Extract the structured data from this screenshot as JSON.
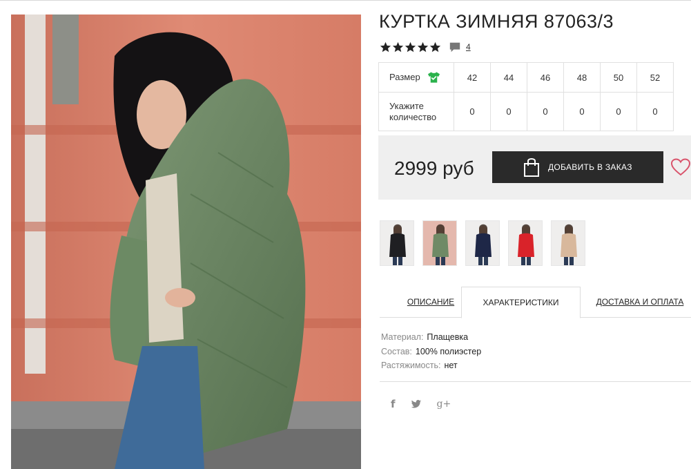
{
  "product": {
    "title": "КУРТКА ЗИМНЯЯ 87063/3",
    "rating": 5,
    "review_count": "4"
  },
  "size_table": {
    "size_label": "Размер",
    "qty_label_line1": "Укажите",
    "qty_label_line2": "количество",
    "sizes": [
      "42",
      "44",
      "46",
      "48",
      "50",
      "52"
    ],
    "quantities": [
      "0",
      "0",
      "0",
      "0",
      "0",
      "0"
    ]
  },
  "purchase": {
    "price": "2999 руб",
    "order_button": "ДОБАВИТЬ В ЗАКАЗ"
  },
  "thumbnails": [
    {
      "jacket_color": "#1f1f22"
    },
    {
      "jacket_color": "#6f8a66"
    },
    {
      "jacket_color": "#1e2747"
    },
    {
      "jacket_color": "#d9232a"
    },
    {
      "jacket_color": "#d8b89c"
    }
  ],
  "tabs": {
    "description": "ОПИСАНИЕ",
    "characteristics": "ХАРАКТЕРИСТИКИ",
    "delivery": "ДОСТАВКА И ОПЛАТА"
  },
  "specs": [
    {
      "key": "Материал:",
      "value": "Плащевка"
    },
    {
      "key": "Состав:",
      "value": "100% полиэстер"
    },
    {
      "key": "Растяжимость:",
      "value": "нет"
    }
  ],
  "social": {
    "facebook": "f",
    "googleplus": "g+"
  },
  "colors": {
    "dark_button": "#2a2a2a",
    "panel_bg": "#efefef",
    "heart": "#d9536b",
    "shirt_icon": "#2bb24c"
  }
}
